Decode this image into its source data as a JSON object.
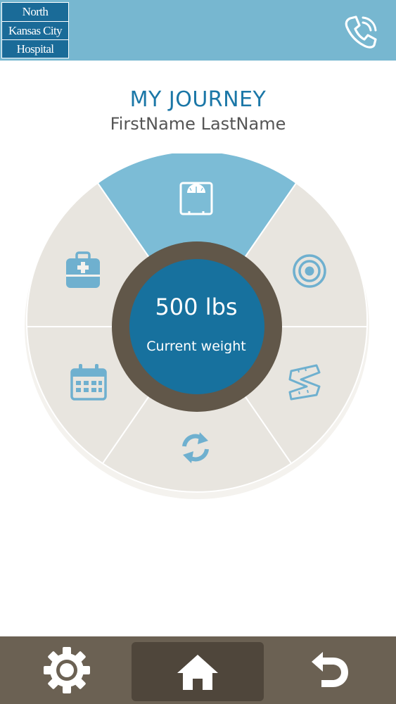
{
  "header": {
    "logo": {
      "line1": "North",
      "line2": "Kansas City",
      "line3": "Hospital"
    },
    "phone_icon": "phone-icon"
  },
  "page": {
    "title": "MY JOURNEY",
    "user_name": "FirstName LastName"
  },
  "wheel": {
    "segments": [
      {
        "icon": "scale-icon",
        "active": true
      },
      {
        "icon": "target-icon",
        "active": false
      },
      {
        "icon": "measuring-tape-icon",
        "active": false
      },
      {
        "icon": "refresh-icon",
        "active": false
      },
      {
        "icon": "calendar-icon",
        "active": false
      },
      {
        "icon": "medical-kit-icon",
        "active": false
      }
    ],
    "center_value": "500 lbs",
    "center_label": "Current weight"
  },
  "tabbar": {
    "items": [
      {
        "icon": "gear-icon",
        "active": false
      },
      {
        "icon": "home-icon",
        "active": true
      },
      {
        "icon": "back-icon",
        "active": false
      }
    ]
  },
  "colors": {
    "header_bg": "#77b7d0",
    "active_segment": "#7cbcd6",
    "inactive_segment": "#e8e5df",
    "icon_blue": "#6fb0cf",
    "center_ring": "#615749",
    "center_fill": "#17719e",
    "title_blue": "#1b77a7",
    "tabbar_bg": "#6b6153"
  }
}
